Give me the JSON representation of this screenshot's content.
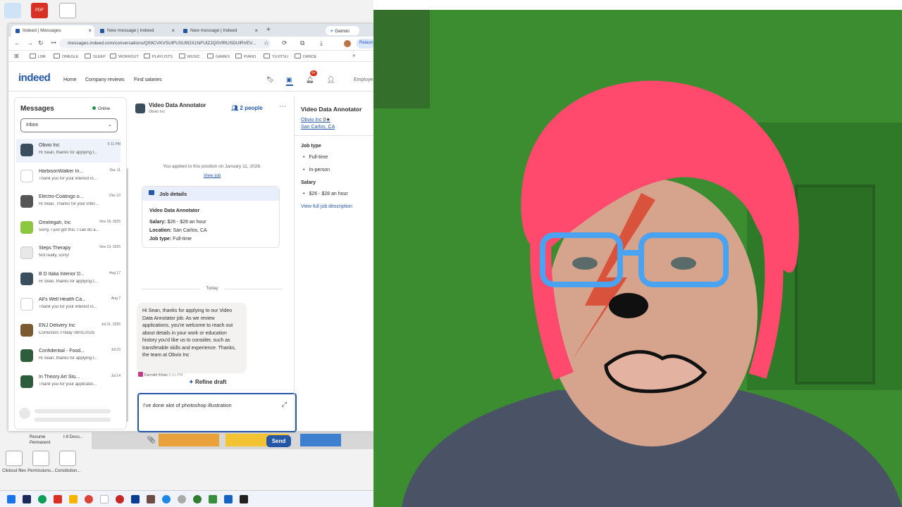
{
  "desktop": {
    "icons_bottom": [
      "Clickout files",
      "Permissions...",
      "Constitution..."
    ],
    "window_labels": [
      "Resume",
      "Permanent",
      "I-9 Docu..."
    ]
  },
  "browser": {
    "tabs": [
      {
        "label": "Indeed | Messages",
        "active": true
      },
      {
        "label": "New message | Indeed",
        "active": false
      },
      {
        "label": "New message | Indeed",
        "active": false
      }
    ],
    "gemini_label": "Gemini",
    "url": "messages.indeed.com/conversations/Q09CVKVSUlFUSU9OX1NFUlZJQ0VfRUSDUlRVEV...",
    "relaunch_label": "Relaun",
    "bookmarks": [
      "LIMI",
      "OMEGLE",
      "SLEEP",
      "WORKOUT",
      "PLAYLISTS",
      "MUSIC",
      "GAMES",
      "PIANO",
      "YUJITSU",
      "DANCE"
    ]
  },
  "indeed": {
    "logo": "indeed",
    "nav": [
      "Home",
      "Company reviews",
      "Find salaries"
    ],
    "notif_count": "9+",
    "employers_label": "Employe"
  },
  "messages": {
    "title": "Messages",
    "status": "Online",
    "filter": "Inbox",
    "conversations": [
      {
        "name": "Obvio Inc",
        "date": "5:11 PM",
        "preview": "Hi Sean, thanks for applying t...",
        "selected": true,
        "avatar_color": "#3b4e5e"
      },
      {
        "name": "HarbisonWalker In...",
        "date": "Dec 11",
        "preview": "Thank you for your interest in...",
        "selected": false,
        "avatar_color": "#ffffff"
      },
      {
        "name": "Electro-Coatings o...",
        "date": "Dec 10",
        "preview": "Hi Sean, Thanks for your inter...",
        "selected": false,
        "avatar_color": "#555555"
      },
      {
        "name": "Omelegah, Inc",
        "date": "Nov 18, 2025",
        "preview": "Sorry, I just got this. I can do a...",
        "selected": false,
        "avatar_color": "#8dc63f"
      },
      {
        "name": "Steps Therapy",
        "date": "Nov 13, 2025",
        "preview": "Not really, sorry!",
        "selected": false,
        "avatar_color": "#e8e8e8"
      },
      {
        "name": "B D Italia Interior D...",
        "date": "Aug 17",
        "preview": "Hi Sean, thanks for applying t...",
        "selected": false,
        "avatar_color": "#3b4e5e"
      },
      {
        "name": "All's Well Health Ca...",
        "date": "Aug 7",
        "preview": "Thank you for your interest in...",
        "selected": false,
        "avatar_color": "#ffffff"
      },
      {
        "name": "ENJ Delivery Inc",
        "date": "Jul 31, 2025",
        "preview": "Correction: Friday 08/01/2025",
        "selected": false,
        "avatar_color": "#7a5a2e"
      },
      {
        "name": "Confidential - Food...",
        "date": "Jul 15",
        "preview": "Hi Sean, thanks for applying t...",
        "selected": false,
        "avatar_color": "#2e5d3b"
      },
      {
        "name": "In Theory Art Stu...",
        "date": "Jul 14",
        "preview": "Thank you for your applicatio...",
        "selected": false,
        "avatar_color": "#2e5d3b"
      }
    ]
  },
  "conversation": {
    "title": "Video Data Annotator",
    "company": "Obvio Inc",
    "people": "2 people",
    "applied_note": "You applied to this position on January 11, 2026.",
    "view_job": "View job",
    "job_details": {
      "header": "Job details",
      "title": "Video Data Annotator",
      "salary_label": "Salary:",
      "salary": "$26 - $28 an hour",
      "location_label": "Location:",
      "location": "San Carlos, CA",
      "jobtype_label": "Job type:",
      "jobtype": "Full-time"
    },
    "today": "Today",
    "message": "Hi Sean, thanks for applying to our Video Data Annotator job. As we review applications, you're welcome to reach out about details in your work or education history you'd like us to consider, such as transferable skills and experience. Thanks, the team at Obvio Inc",
    "sender": "Farrukh Khan",
    "sender_time": "5:11 PM",
    "refine_label": "Refine draft",
    "compose_text": "I've done alot of photoshop illustration",
    "send_label": "Send"
  },
  "job_panel": {
    "title": "Video Data Annotator",
    "company": "Obvio Inc",
    "rating": "0",
    "location": "San Carlos, CA",
    "job_type_heading": "Job type",
    "job_types": [
      "Full-time",
      "In-person"
    ],
    "salary_heading": "Salary",
    "salary": "$26 - $28 an hour",
    "full_desc_link": "View full job description"
  },
  "colors": {
    "brand": "#2557a7",
    "webcam_wall": "#3a8a2e",
    "hair": "#ff4a6e"
  }
}
